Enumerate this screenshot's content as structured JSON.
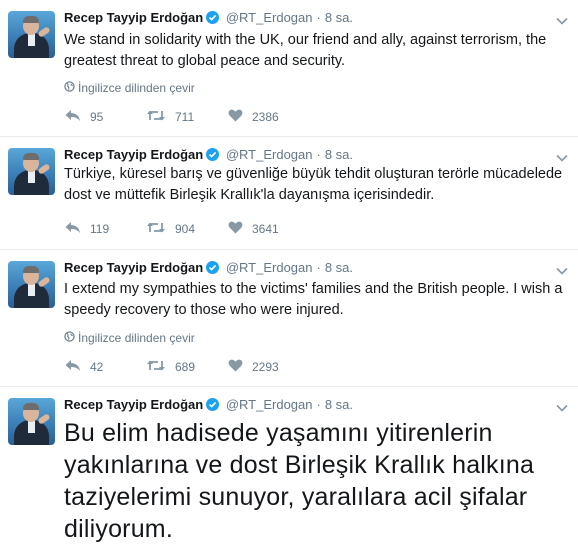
{
  "tweets": [
    {
      "name": "Recep Tayyip Erdoğan",
      "handle": "@RT_Erdogan",
      "dot": "·",
      "time": "8 sa.",
      "text": "We stand in solidarity with the UK, our friend and ally, against terrorism, the greatest threat to global peace and security.",
      "translate": "İngilizce dilinden çevir",
      "replies": "95",
      "retweets": "711",
      "likes": "2386"
    },
    {
      "name": "Recep Tayyip Erdoğan",
      "handle": "@RT_Erdogan",
      "dot": "·",
      "time": "8 sa.",
      "text": "Türkiye, küresel barış ve güvenliğe büyük tehdit oluşturan terörle mücadelede dost ve müttefik Birleşik Krallık'la dayanışma içerisindedir.",
      "replies": "119",
      "retweets": "904",
      "likes": "3641"
    },
    {
      "name": "Recep Tayyip Erdoğan",
      "handle": "@RT_Erdogan",
      "dot": "·",
      "time": "8 sa.",
      "text": "I extend my sympathies to the victims' families and the British people. I wish a speedy recovery to those who were injured.",
      "translate": "İngilizce dilinden çevir",
      "replies": "42",
      "retweets": "689",
      "likes": "2293"
    },
    {
      "name": "Recep Tayyip Erdoğan",
      "handle": "@RT_Erdogan",
      "dot": "·",
      "time": "8 sa.",
      "text": "Bu elim hadisede yaşamını yitirenlerin yakınlarına ve dost Birleşik Krallık halkına taziyelerimi sunuyor, yaralılara acil şifalar diliyorum."
    }
  ],
  "colors": {
    "verified": "#1da1f2",
    "muted": "#657786",
    "text": "#14171a",
    "divider": "#e6ecf0"
  },
  "icons": [
    "verified-badge-icon",
    "chevron-down-icon",
    "globe-icon",
    "reply-icon",
    "retweet-icon",
    "heart-icon"
  ]
}
